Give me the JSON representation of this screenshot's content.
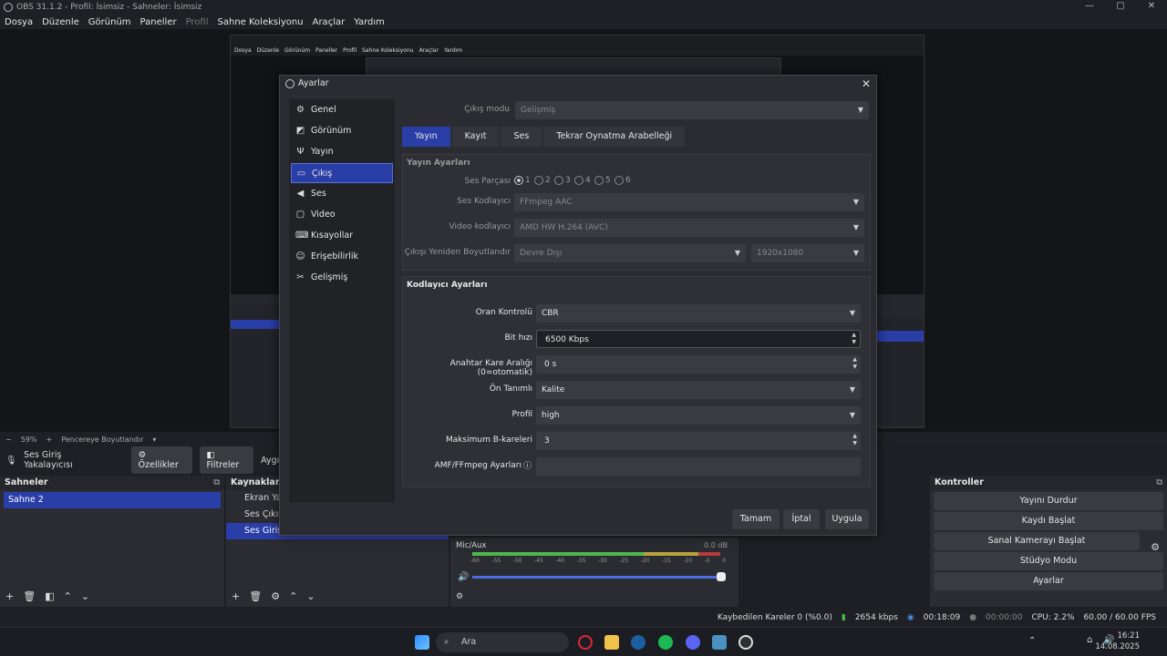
{
  "window": {
    "title": "OBS 31.1.2 - Profil: İsimsiz - Sahneler: İsimsiz",
    "controls": [
      "—",
      "▢",
      "✕"
    ]
  },
  "menu": [
    "Dosya",
    "Düzenle",
    "Görünüm",
    "Paneller",
    "Profil",
    "Sahne Koleksiyonu",
    "Araçlar",
    "Yardım"
  ],
  "preview": {
    "zoom": "59%",
    "zoom_mode": "Pencereye Boyutlandır"
  },
  "source_bar": {
    "source_name": "Ses Giriş Yakalayıcısı",
    "properties": "Özellikler",
    "filters": "Filtreler",
    "device": "Aygıt"
  },
  "scenes": {
    "header": "Sahneler",
    "items": [
      "Sahne 2"
    ]
  },
  "sources": {
    "header": "Kaynaklar",
    "items": [
      "Ekran Yak",
      "Ses Çıkış Y",
      "Ses Giriş Yakalayıcısı"
    ]
  },
  "mixer": {
    "channel": "Mic/Aux",
    "level": "0.0 dB",
    "scale": [
      "-60",
      "-55",
      "-50",
      "-45",
      "-40",
      "-35",
      "-30",
      "-25",
      "-20",
      "-15",
      "-10",
      "-5",
      "0"
    ]
  },
  "controls": {
    "header": "Kontroller",
    "stop_stream": "Yayını Durdur",
    "start_record": "Kaydı Başlat",
    "virtual_cam": "Sanal Kamerayı Başlat",
    "studio_mode": "Stüdyo Modu",
    "settings": "Ayarlar"
  },
  "status": {
    "dropped": "Kaybedilen Kareler 0 (%0.0)",
    "bitrate": "2654 kbps",
    "stream_time": "00:18:09",
    "record_time": "00:00:00",
    "cpu": "CPU: 2.2%",
    "fps": "60.00 / 60.00 FPS"
  },
  "taskbar": {
    "search": "Ara",
    "time": "16:21",
    "date": "14.08.2025"
  },
  "dialog": {
    "title": "Ayarlar",
    "nav": [
      "Genel",
      "Görünüm",
      "Yayın",
      "Çıkış",
      "Ses",
      "Video",
      "Kısayollar",
      "Erişebilirlik",
      "Gelişmiş"
    ],
    "nav_active": 3,
    "output_mode_label": "Çıkış modu",
    "output_mode_value": "Gelişmiş",
    "tabs": [
      "Yayın",
      "Kayıt",
      "Ses",
      "Tekrar Oynatma Arabelleği"
    ],
    "stream_settings": {
      "header": "Yayın Ayarları",
      "audio_track_label": "Ses Parçası",
      "tracks": [
        "1",
        "2",
        "3",
        "4",
        "5",
        "6"
      ],
      "audio_encoder_label": "Ses Kodlayıcı",
      "audio_encoder_value": "FFmpeg AAC",
      "video_encoder_label": "Video kodlayıcı",
      "video_encoder_value": "AMD HW H.264 (AVC)",
      "rescale_label": "Çıkışı Yeniden Boyutlandır",
      "rescale_value": "Devre Dışı",
      "rescale_res": "1920x1080"
    },
    "encoder_settings": {
      "header": "Kodlayıcı Ayarları",
      "rate_control_label": "Oran Kontrolü",
      "rate_control_value": "CBR",
      "bitrate_label": "Bit hızı",
      "bitrate_value": "6500 Kbps",
      "keyframe_label": "Anahtar Kare Aralığı (0=otomatik)",
      "keyframe_value": "0 s",
      "preset_label": "Ön Tanımlı",
      "preset_value": "Kalite",
      "profile_label": "Profil",
      "profile_value": "high",
      "bframes_label": "Maksimum B-kareleri",
      "bframes_value": "3",
      "ffmpeg_label": "AMF/FFmpeg Ayarları",
      "ffmpeg_value": ""
    },
    "buttons": {
      "ok": "Tamam",
      "cancel": "İptal",
      "apply": "Uygula"
    }
  }
}
